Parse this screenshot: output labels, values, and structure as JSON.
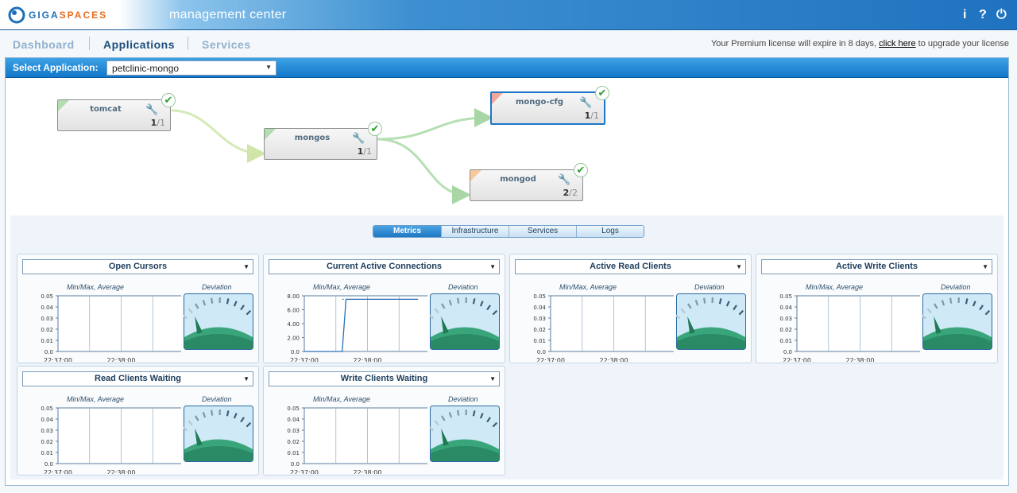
{
  "header": {
    "logo": {
      "giga": "GIGA",
      "spaces": "SPACES"
    },
    "title": "management center",
    "icons": {
      "info": "i",
      "help": "?",
      "power": "⏻"
    }
  },
  "nav": {
    "dashboard": "Dashboard",
    "applications": "Applications",
    "services": "Services",
    "license_prefix": "Your Premium license will expire in 8 days,",
    "license_link": "click here",
    "license_suffix": "to upgrade your license"
  },
  "select_app": {
    "label": "Select Application:",
    "value": "petclinic-mongo"
  },
  "topology": {
    "nodes": [
      {
        "id": "tomcat",
        "label": "tomcat",
        "running": "1",
        "total": "/1",
        "status": "ok",
        "corner_color": "#b3dcb0",
        "selected": false
      },
      {
        "id": "mongos",
        "label": "mongos",
        "running": "1",
        "total": "/1",
        "status": "ok",
        "corner_color": "#b3dcb0",
        "selected": false
      },
      {
        "id": "mongo-cfg",
        "label": "mongo-cfg",
        "running": "1",
        "total": "/1",
        "status": "ok",
        "corner_color": "#f2a79a",
        "selected": true
      },
      {
        "id": "mongod",
        "label": "mongod",
        "running": "2",
        "total": "/2",
        "status": "ok",
        "corner_color": "#f7c89a",
        "selected": false
      }
    ]
  },
  "tabs": [
    "Metrics",
    "Infrastructure",
    "Services",
    "Logs"
  ],
  "active_tab": "Metrics",
  "metrics": {
    "left_sub": "Min/Max, Average",
    "right_sub": "Deviation",
    "panels": [
      {
        "title": "Open Cursors"
      },
      {
        "title": "Current Active Connections"
      },
      {
        "title": "Active Read Clients"
      },
      {
        "title": "Active Write Clients"
      },
      {
        "title": "Read Clients Waiting"
      },
      {
        "title": "Write Clients Waiting"
      }
    ]
  },
  "chart_data": [
    {
      "type": "line",
      "title": "Open Cursors",
      "x_ticks": [
        "22:37:00",
        "22:38:00"
      ],
      "y_ticks": [
        "0.0",
        "0.01",
        "0.02",
        "0.03",
        "0.04",
        "0.05"
      ],
      "ylim": [
        0,
        0.05
      ],
      "series": [],
      "grid": true
    },
    {
      "type": "line",
      "title": "Current Active Connections",
      "x_ticks": [
        "22:37:00",
        "22:38:00"
      ],
      "y_ticks": [
        "0.0",
        "2.00",
        "4.00",
        "6.00",
        "8.00"
      ],
      "ylim": [
        0,
        8
      ],
      "series": [
        {
          "x": [
            0.0,
            0.3,
            0.33,
            0.9
          ],
          "values": [
            0,
            0,
            7.5,
            7.5
          ]
        }
      ],
      "grid": true
    },
    {
      "type": "line",
      "title": "Active Read Clients",
      "x_ticks": [
        "22:37:00",
        "22:38:00"
      ],
      "y_ticks": [
        "0.0",
        "0.01",
        "0.02",
        "0.03",
        "0.04",
        "0.05"
      ],
      "ylim": [
        0,
        0.05
      ],
      "series": [],
      "grid": true
    },
    {
      "type": "line",
      "title": "Active Write Clients",
      "x_ticks": [
        "22:37:00",
        "22:38:00"
      ],
      "y_ticks": [
        "0.0",
        "0.01",
        "0.02",
        "0.03",
        "0.04",
        "0.05"
      ],
      "ylim": [
        0,
        0.05
      ],
      "series": [],
      "grid": true
    },
    {
      "type": "line",
      "title": "Read Clients Waiting",
      "x_ticks": [
        "22:37:00",
        "22:38:00"
      ],
      "y_ticks": [
        "0.0",
        "0.01",
        "0.02",
        "0.03",
        "0.04",
        "0.05"
      ],
      "ylim": [
        0,
        0.05
      ],
      "series": [],
      "grid": true
    },
    {
      "type": "line",
      "title": "Write Clients Waiting",
      "x_ticks": [
        "22:37:00",
        "22:38:00"
      ],
      "y_ticks": [
        "0.0",
        "0.01",
        "0.02",
        "0.03",
        "0.04",
        "0.05"
      ],
      "ylim": [
        0,
        0.05
      ],
      "series": [],
      "grid": true
    }
  ]
}
